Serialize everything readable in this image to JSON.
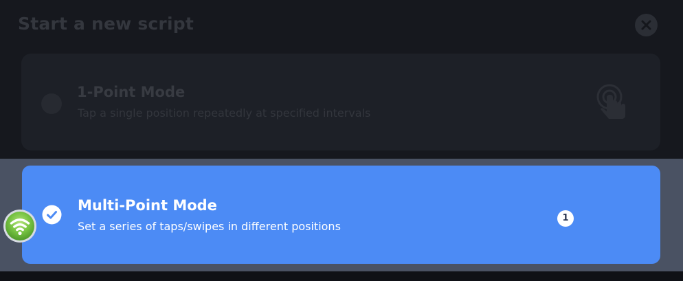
{
  "dialog": {
    "title": "Start a new script",
    "close_icon": "close-icon"
  },
  "modes": [
    {
      "title": "1-Point Mode",
      "description": "Tap a single position repeatedly at specified intervals",
      "selected": false,
      "icon": "tap-hand-icon"
    },
    {
      "title": "Multi-Point Mode",
      "description": "Set a series of taps/swipes in different positions",
      "selected": true,
      "badge": "1",
      "icon": "check-icon"
    }
  ],
  "overlay": {
    "icon": "wifi-icon"
  },
  "colors": {
    "accent": "#4c8bf5",
    "background": "#16181e",
    "card": "#1d2027",
    "overlay_bottom": "#4a5263"
  }
}
